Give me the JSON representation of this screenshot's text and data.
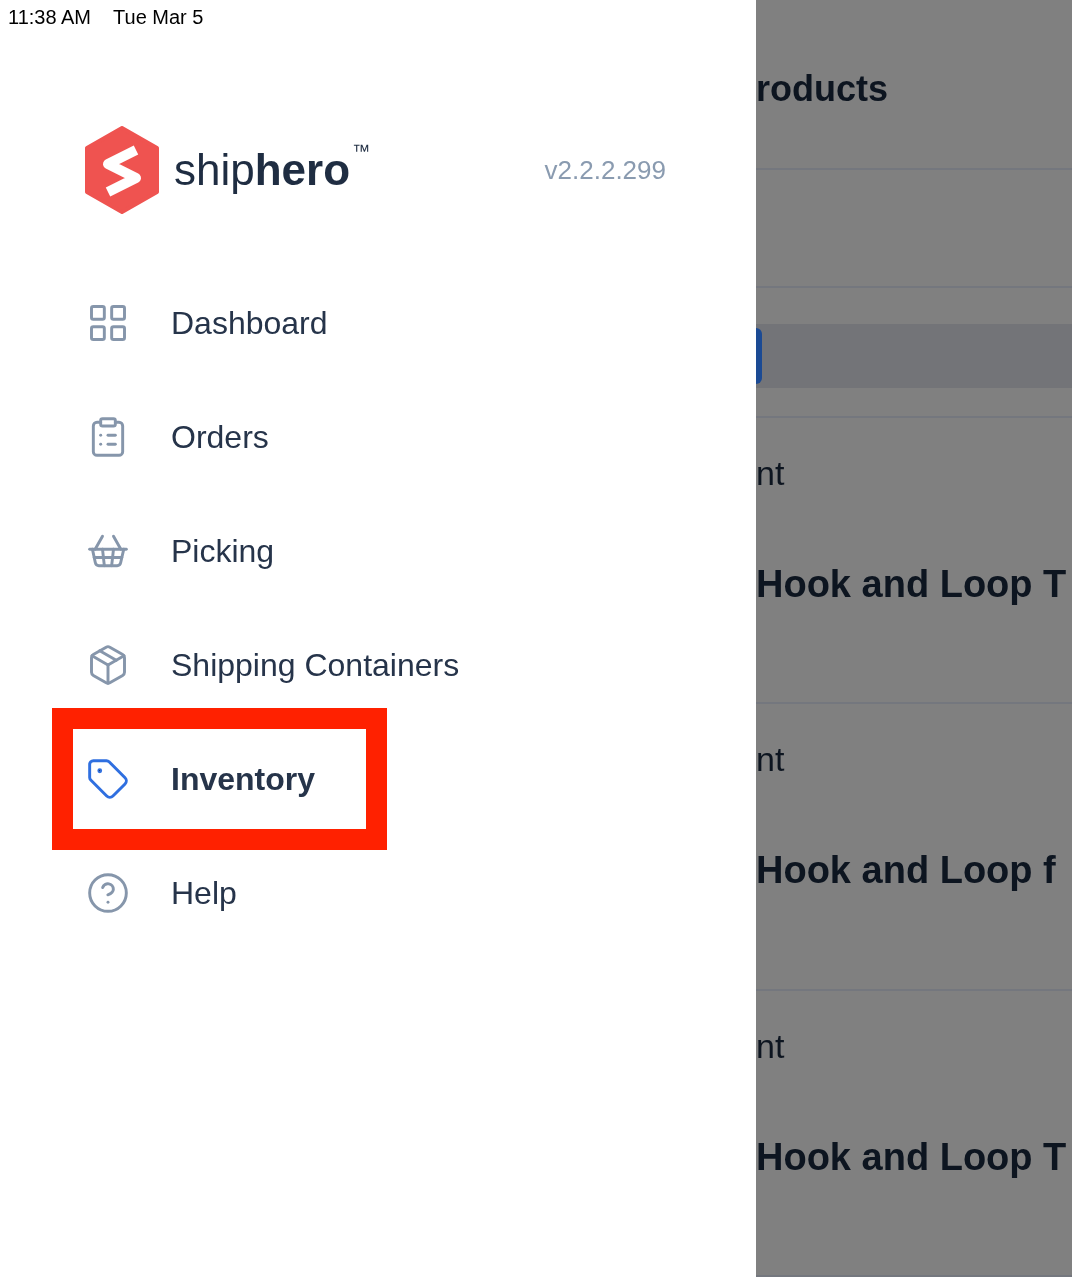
{
  "status_bar": {
    "time": "11:38 AM",
    "date": "Tue Mar 5"
  },
  "drawer": {
    "logo": "ship**hero**$^{™}$",
    "version": "v2.2.2.299",
    "items": [
      {
        "label": "Dashboard",
        "selected": false,
        "highlighted": false
      },
      {
        "label": "Orders",
        "selected": false,
        "highlighted": false
      },
      {
        "label": "Picking",
        "selected": false,
        "highlighted": false
      },
      {
        "label": "Shipping Containers",
        "selected": false,
        "highlighted": false
      },
      {
        "label": "Inventory",
        "selected": true,
        "highlighted": true
      },
      {
        "label": "Help",
        "selected": false,
        "highlighted": false
      }
    ]
  },
  "background": {
    "title": "roducts",
    "rows": [
      {
        "column_1": "nt",
        "column_2": "Hook and Loop T"
      },
      {
        "column_1": "nt",
        "column_2": "Hook and Loop f"
      },
      {
        "column_1": "nt",
        "column_2": "Hook and Loop T"
      }
    ]
  }
}
